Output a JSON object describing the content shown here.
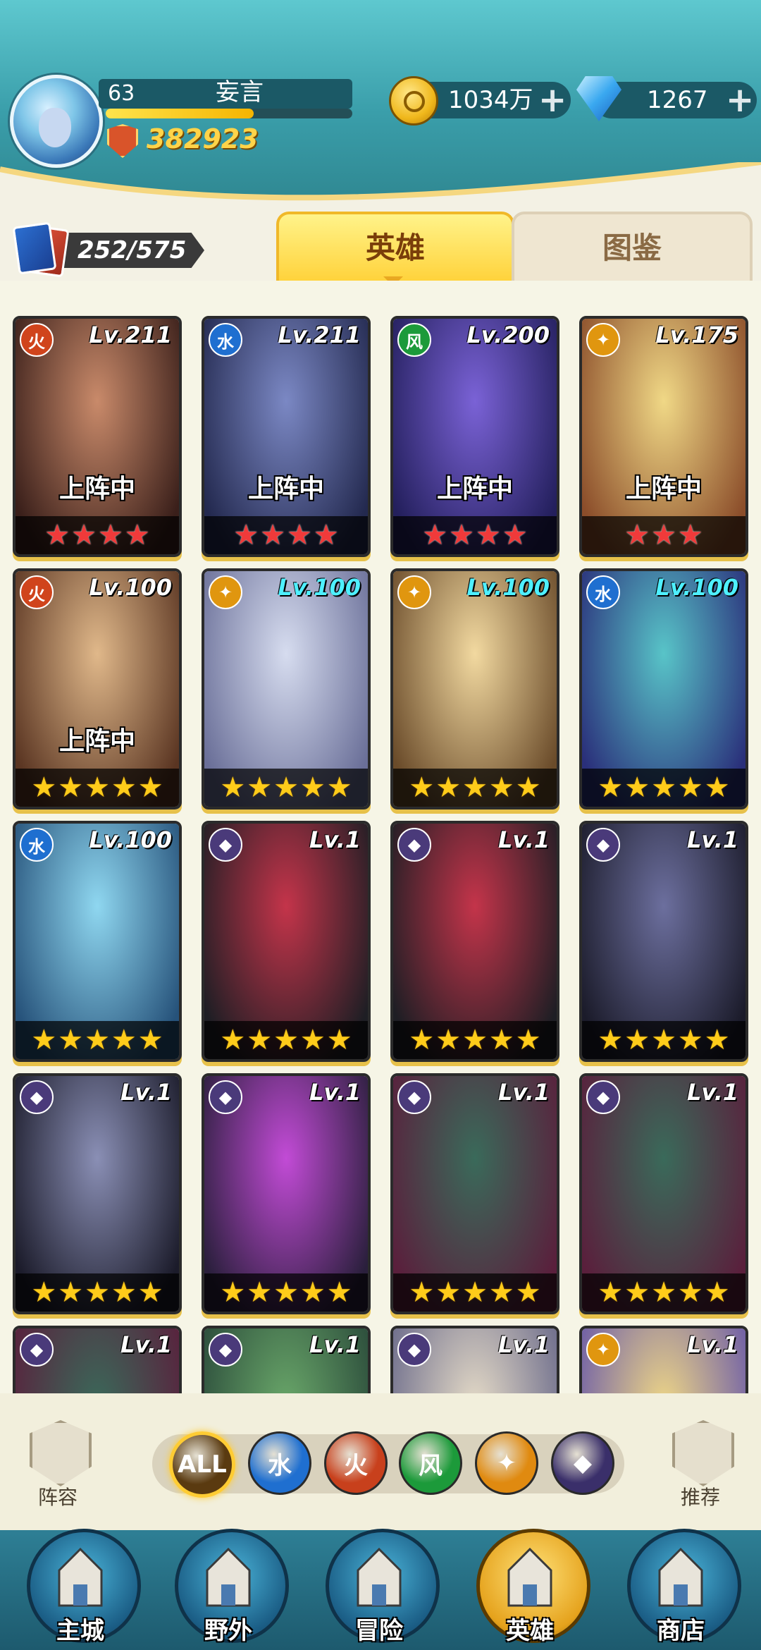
{
  "player": {
    "level": "63",
    "name": "妄言",
    "power": "382923",
    "exp_fraction": 0.6
  },
  "resources": {
    "gold": "1034万",
    "gems": "1267"
  },
  "hero_count": "252/575",
  "tabs": [
    {
      "label": "英雄",
      "active": true
    },
    {
      "label": "图鉴",
      "active": false
    }
  ],
  "heroes": [
    {
      "level": "Lv.211",
      "element": "fire",
      "deploy": "上阵中",
      "stars": 4,
      "star_color": "red",
      "art": "#c98a6a,#3a1f1a"
    },
    {
      "level": "Lv.211",
      "element": "water",
      "deploy": "上阵中",
      "stars": 4,
      "star_color": "red",
      "art": "#7b88c4,#23294f"
    },
    {
      "level": "Lv.200",
      "element": "wind",
      "deploy": "上阵中",
      "stars": 4,
      "star_color": "red",
      "art": "#7a62d6,#231f5c"
    },
    {
      "level": "Lv.175",
      "element": "light",
      "deploy": "上阵中",
      "stars": 3,
      "star_color": "red",
      "art": "#f0d886,#8b4d2a"
    },
    {
      "level": "Lv.100",
      "element": "fire",
      "deploy": "上阵中",
      "stars": 5,
      "star_color": "gold",
      "art": "#e0b88a,#5a3522"
    },
    {
      "level": "Lv.100",
      "element": "light",
      "deploy": "",
      "stars": 5,
      "star_color": "gold",
      "art": "#d6dcef,#6a6f98"
    },
    {
      "level": "Lv.100",
      "element": "light",
      "deploy": "",
      "stars": 5,
      "star_color": "gold",
      "art": "#f2d9a0,#6a4b2a"
    },
    {
      "level": "Lv.100",
      "element": "water",
      "deploy": "",
      "stars": 5,
      "star_color": "gold",
      "art": "#58c4c8,#2a2f7a"
    },
    {
      "level": "Lv.100",
      "element": "water",
      "deploy": "",
      "stars": 5,
      "star_color": "gold",
      "art": "#8fd7f0,#26527a"
    },
    {
      "level": "Lv.1",
      "element": "dark",
      "deploy": "",
      "stars": 5,
      "star_color": "gold",
      "art": "#c4344a,#1e1e24"
    },
    {
      "level": "Lv.1",
      "element": "dark",
      "deploy": "",
      "stars": 5,
      "star_color": "gold",
      "art": "#c4344a,#1e1e24"
    },
    {
      "level": "Lv.1",
      "element": "dark",
      "deploy": "",
      "stars": 5,
      "star_color": "gold",
      "art": "#6c6f9e,#1b1b2a"
    },
    {
      "level": "Lv.1",
      "element": "dark",
      "deploy": "",
      "stars": 5,
      "star_color": "gold",
      "art": "#8a8fb5,#1b1b2a"
    },
    {
      "level": "Lv.1",
      "element": "dark",
      "deploy": "",
      "stars": 5,
      "star_color": "gold",
      "art": "#c24bd6,#2a1f3c"
    },
    {
      "level": "Lv.1",
      "element": "dark",
      "deploy": "",
      "stars": 5,
      "star_color": "gold",
      "art": "#3a6a5a,#5a1f3c"
    },
    {
      "level": "Lv.1",
      "element": "dark",
      "deploy": "",
      "stars": 5,
      "star_color": "gold",
      "art": "#3a6a5a,#5a1f3c"
    },
    {
      "level": "Lv.1",
      "element": "dark",
      "deploy": "",
      "stars": 0,
      "star_color": "gold",
      "art": "#3a6a5a,#5a1f3c"
    },
    {
      "level": "Lv.1",
      "element": "dark",
      "deploy": "",
      "stars": 0,
      "star_color": "gold",
      "art": "#6aa86a,#2a4a3a"
    },
    {
      "level": "Lv.1",
      "element": "dark",
      "deploy": "",
      "stars": 0,
      "star_color": "gold",
      "art": "#e6dcc8,#6a6a8a"
    },
    {
      "level": "Lv.1",
      "element": "light",
      "deploy": "",
      "stars": 0,
      "star_color": "gold",
      "art": "#f0d886,#6a5aa8"
    }
  ],
  "filter": {
    "left_label": "阵容",
    "right_label": "推荐",
    "buttons": [
      {
        "id": "all",
        "label": "ALL",
        "color": "#5a3a10",
        "selected": true
      },
      {
        "id": "water",
        "label": "",
        "color": "#1f6fd0"
      },
      {
        "id": "fire",
        "label": "",
        "color": "#c8401c"
      },
      {
        "id": "wind",
        "label": "",
        "color": "#1c9a3a"
      },
      {
        "id": "light",
        "label": "",
        "color": "#e08a10"
      },
      {
        "id": "dark",
        "label": "",
        "color": "#3a2f6a"
      }
    ]
  },
  "nav": [
    {
      "label": "主城",
      "active": false
    },
    {
      "label": "野外",
      "active": false
    },
    {
      "label": "冒险",
      "active": false
    },
    {
      "label": "英雄",
      "active": true
    },
    {
      "label": "商店",
      "active": false
    }
  ],
  "element_colors": {
    "fire": "#d0441c",
    "water": "#1f6fd0",
    "wind": "#1c9a3a",
    "light": "#e0960f",
    "dark": "#4a3a7a"
  },
  "element_glyphs": {
    "fire": "火",
    "water": "水",
    "wind": "风",
    "light": "✦",
    "dark": "◆"
  }
}
